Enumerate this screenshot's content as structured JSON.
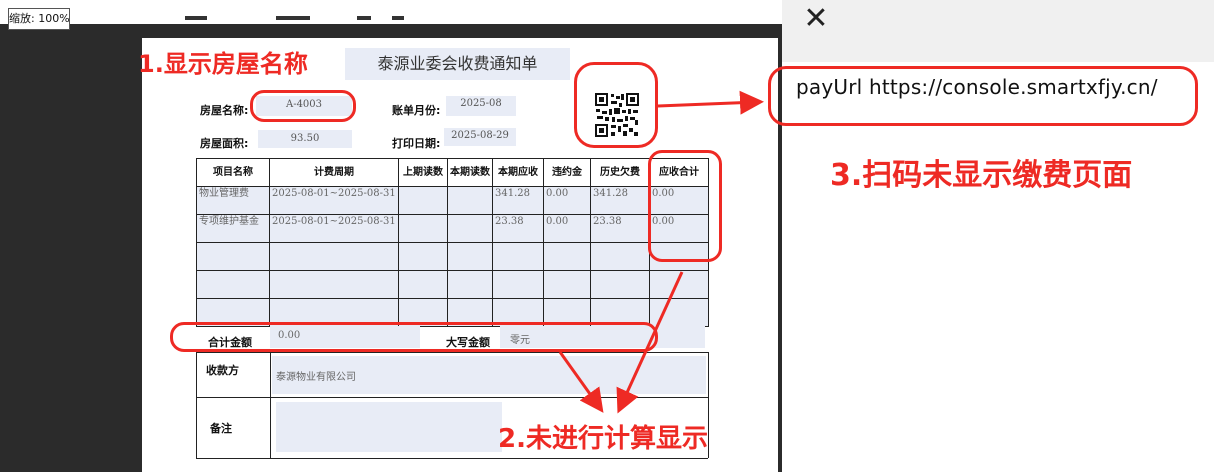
{
  "viewer": {
    "zoom_label": "缩放: 100%"
  },
  "right_panel": {
    "close_icon": "close-icon",
    "pay_url_text": "payUrl https://console.smartxfjy.cn/"
  },
  "document": {
    "title": "泰源业委会收费通知单",
    "house_name_label": "房屋名称:",
    "house_name_value": "A-4003",
    "bill_month_label": "账单月份:",
    "bill_month_value": "2025-08",
    "house_area_label": "房屋面积:",
    "house_area_value": "93.50",
    "print_date_label": "打印日期:",
    "print_date_value": "2025-08-29",
    "qr_icon": "qr-code-icon",
    "table": {
      "headers": [
        "项目名称",
        "计费周期",
        "上期读数",
        "本期读数",
        "本期应收",
        "违约金",
        "历史欠费",
        "应收合计"
      ],
      "rows": [
        [
          "物业管理费",
          "2025-08-01~2025-08-31",
          "",
          "",
          "341.28",
          "0.00",
          "341.28",
          "0.00"
        ],
        [
          "专项维护基金",
          "2025-08-01~2025-08-31",
          "",
          "",
          "23.38",
          "0.00",
          "23.38",
          "0.00"
        ]
      ]
    },
    "total_label": "合计金额",
    "total_value": "0.00",
    "uppercase_label": "大写金额",
    "uppercase_value": "零元",
    "payee_label": "收款方",
    "payee_value": "泰源物业有限公司",
    "remark_label": "备注"
  },
  "annotations": {
    "note1": "1.显示房屋名称",
    "note2": "2.未进行计算显示",
    "note3": "3.扫码未显示缴费页面",
    "color": "#ee2a24"
  }
}
